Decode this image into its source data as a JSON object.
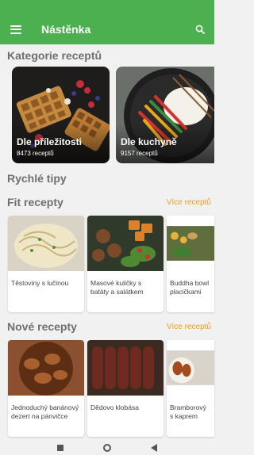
{
  "app": {
    "title": "Nástěnka"
  },
  "colors": {
    "primary": "#4caf50",
    "accent": "#f29d19"
  },
  "icons": {
    "menu": "hamburger-menu-icon",
    "search": "search-icon"
  },
  "sections": {
    "categories": {
      "title": "Kategorie receptů",
      "items": [
        {
          "name": "Dle příležitosti",
          "count": "8473 receptů"
        },
        {
          "name": "Dle kuchyně",
          "count": "9157 receptů"
        }
      ]
    },
    "tips": {
      "title": "Rychlé tipy"
    },
    "fit": {
      "title": "Fit recepty",
      "more": "Více receptů",
      "items": [
        {
          "label": "Těstoviny s lučinou"
        },
        {
          "label": "Masové kuličky s batáty a salátkem"
        },
        {
          "label": "Buddha bowl placičkami"
        }
      ]
    },
    "new": {
      "title": "Nové recepty",
      "more": "Více receptů",
      "items": [
        {
          "label": "Jednoduchý banánový dezert na pánvičce"
        },
        {
          "label": "Dědovo klobása"
        },
        {
          "label": "Bramborový s kaprem"
        }
      ]
    }
  }
}
